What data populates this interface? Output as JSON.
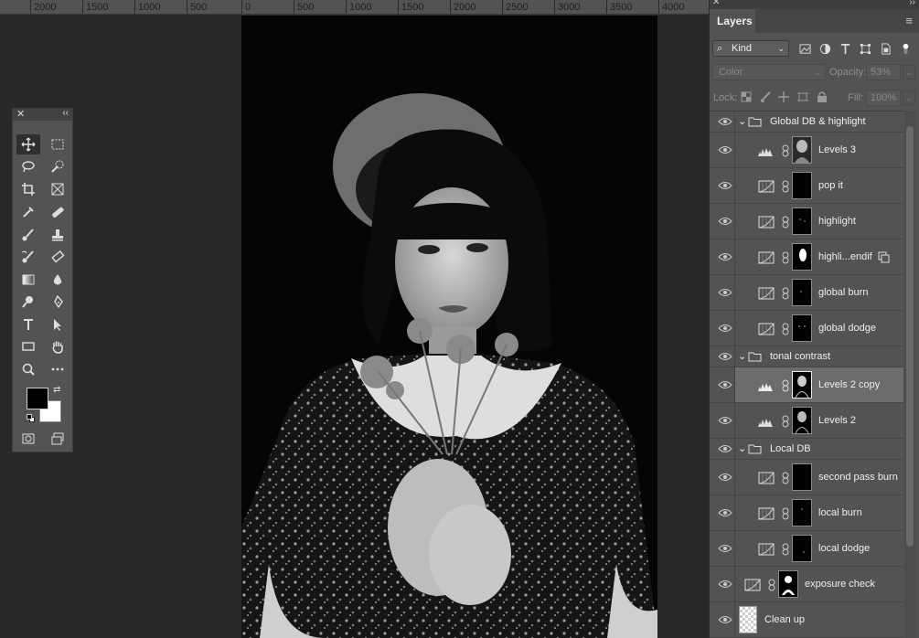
{
  "ruler": {
    "labels": [
      "2000",
      "1500",
      "1000",
      "500",
      "0",
      "500",
      "1000",
      "1500",
      "2000",
      "2500",
      "3000",
      "3500",
      "4000"
    ]
  },
  "layers_panel": {
    "tab_label": "Layers",
    "filter_kind": "Kind",
    "blend_mode": "Color",
    "opacity_label": "Opacity:",
    "opacity_value": "53%",
    "lock_label": "Lock:",
    "fill_label": "Fill:",
    "fill_value": "100%",
    "layers": [
      {
        "type": "group",
        "name": "Global DB & highlight"
      },
      {
        "type": "levels",
        "name": "Levels 3"
      },
      {
        "type": "curves",
        "name": "pop it"
      },
      {
        "type": "curves",
        "name": "highlight"
      },
      {
        "type": "curves",
        "name": "highli...endif"
      },
      {
        "type": "curves",
        "name": "global burn"
      },
      {
        "type": "curves",
        "name": "global dodge"
      },
      {
        "type": "group",
        "name": "tonal contrast"
      },
      {
        "type": "levels",
        "name": "Levels 2 copy",
        "selected": true
      },
      {
        "type": "levels",
        "name": "Levels 2"
      },
      {
        "type": "group",
        "name": "Local DB"
      },
      {
        "type": "curves",
        "name": "second pass burn"
      },
      {
        "type": "curves",
        "name": "local burn"
      },
      {
        "type": "curves",
        "name": "local dodge"
      },
      {
        "type": "curves",
        "name": "exposure check"
      },
      {
        "type": "pixel",
        "name": "Clean up"
      }
    ]
  },
  "colors": {
    "foreground": "#000000",
    "background": "#ffffff",
    "panel": "#535353",
    "selected_layer": "#6c6c6c"
  }
}
